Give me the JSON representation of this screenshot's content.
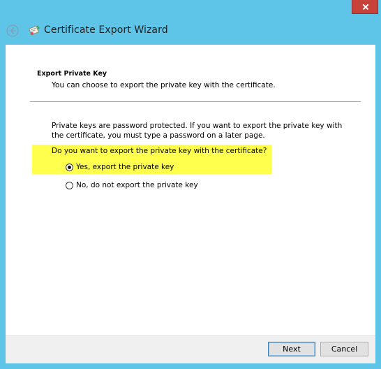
{
  "window": {
    "title": "Certificate Export Wizard",
    "colors": {
      "frame": "#5ec5e8",
      "close_button": "#c6423a",
      "highlight": "#ffff4d"
    }
  },
  "header": {
    "back_icon": "back-arrow-icon",
    "wizard_icon": "certificate-icon"
  },
  "section": {
    "title": "Export Private Key",
    "subtitle": "You can choose to export the private key with the certificate."
  },
  "body": {
    "info": "Private keys are password protected. If you want to export the private key with the certificate, you must type a password on a later page.",
    "question": "Do you want to export the private key with the certificate?"
  },
  "options": [
    {
      "label": "Yes, export the private key",
      "selected": true
    },
    {
      "label": "No, do not export the private key",
      "selected": false
    }
  ],
  "footer": {
    "next_label": "Next",
    "cancel_label": "Cancel"
  }
}
